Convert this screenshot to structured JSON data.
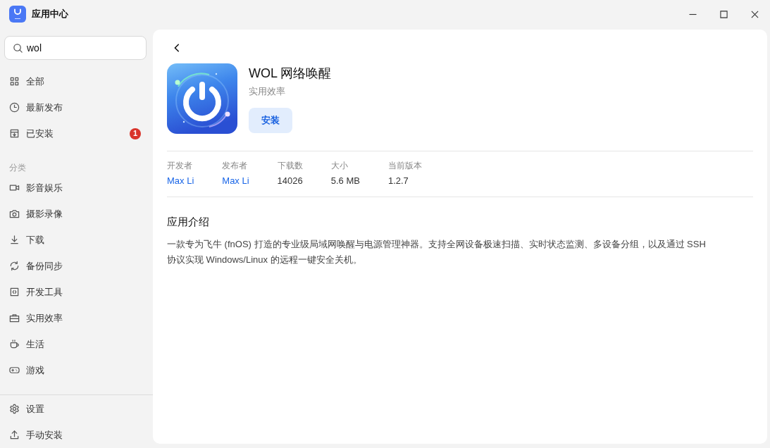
{
  "window": {
    "title": "应用中心"
  },
  "sidebar": {
    "search": {
      "value": "wol"
    },
    "nav_items": [
      {
        "label": "全部",
        "selected": false
      },
      {
        "label": "最新发布",
        "selected": false
      },
      {
        "label": "已安装",
        "selected": false,
        "badge": "1"
      }
    ],
    "category_heading": "分类",
    "categories": [
      {
        "label": "影音娱乐",
        "selected": false
      },
      {
        "label": "摄影录像",
        "selected": false
      },
      {
        "label": "下载",
        "selected": false
      },
      {
        "label": "备份同步",
        "selected": false
      },
      {
        "label": "开发工具",
        "selected": false
      },
      {
        "label": "实用效率",
        "selected": false
      },
      {
        "label": "生活",
        "selected": false
      },
      {
        "label": "游戏",
        "selected": false
      }
    ],
    "footer_items": [
      {
        "label": "设置",
        "selected": false
      },
      {
        "label": "手动安装",
        "selected": false
      }
    ]
  },
  "detail": {
    "app": {
      "name": "WOL 网络唤醒",
      "category": "实用效率",
      "install_label": "安装"
    },
    "stats": [
      {
        "label": "开发者",
        "value": "Max Li",
        "kind": "link"
      },
      {
        "label": "发布者",
        "value": "Max Li",
        "kind": "link"
      },
      {
        "label": "下载数",
        "value": "14026",
        "kind": "text"
      },
      {
        "label": "大小",
        "value": "5.6 MB",
        "kind": "text"
      },
      {
        "label": "当前版本",
        "value": "1.2.7",
        "kind": "text"
      }
    ],
    "description": {
      "heading": "应用介绍",
      "text": "一款专为飞牛 (fnOS) 打造的专业级局域网唤醒与电源管理神器。支持全网设备极速扫描、实时状态监测、多设备分组，以及通过 SSH 协议实现 Windows/Linux 的远程一键安全关机。"
    }
  }
}
